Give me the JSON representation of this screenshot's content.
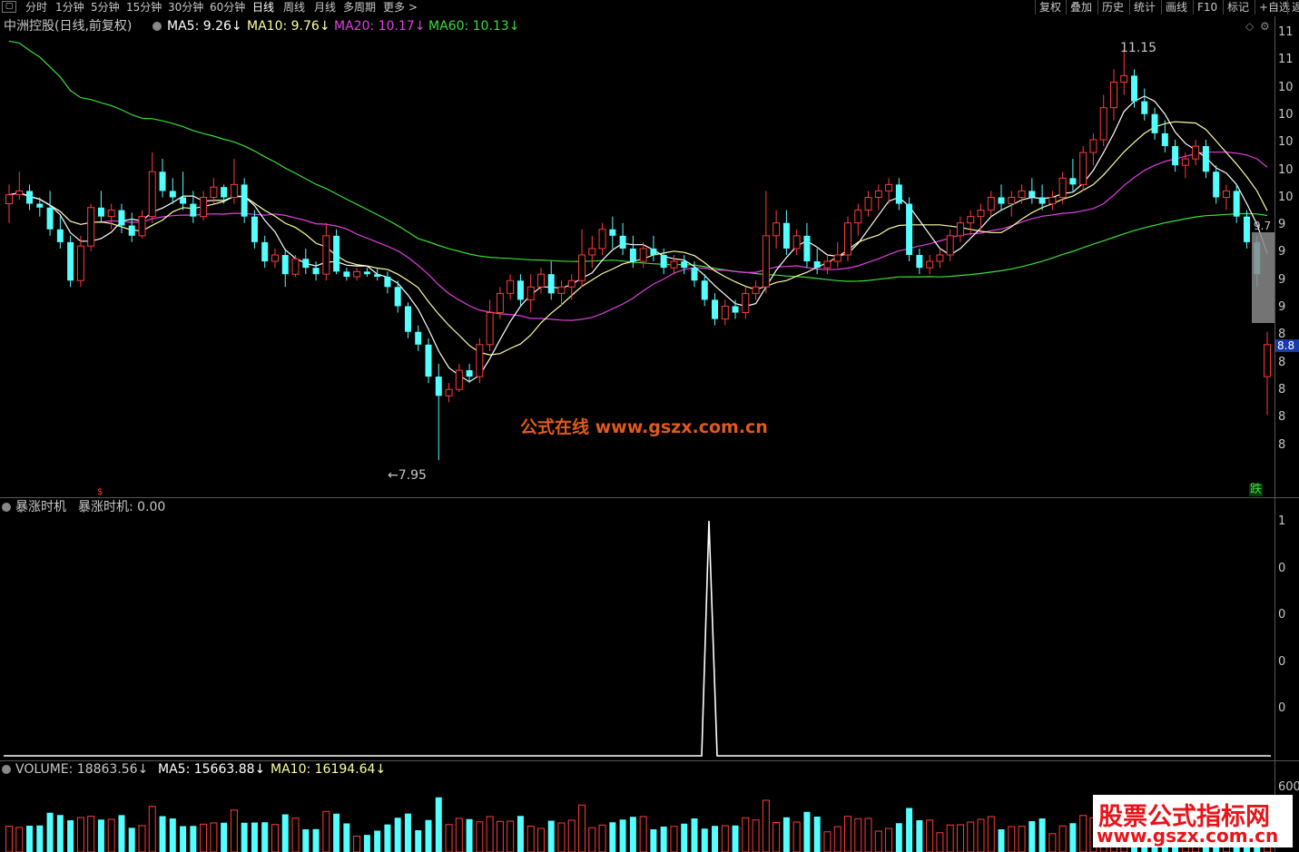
{
  "toolbar": {
    "periods": [
      "分时",
      "1分钟",
      "5分钟",
      "15分钟",
      "30分钟",
      "60分钟",
      "日线",
      "周线",
      "月线",
      "多周期",
      "更多 >"
    ],
    "active_period": "日线",
    "right_buttons": [
      "复权",
      "叠加",
      "历史",
      "统计",
      "画线",
      "F10",
      "标记",
      "+自选",
      "返"
    ]
  },
  "main_panel": {
    "title": "中洲控股(日线,前复权)",
    "ma5": "MA5: 9.26",
    "ma10": "MA10: 9.76",
    "ma20": "MA20: 10.17",
    "ma60": "MA60: 10.13",
    "high_label": "11.15",
    "low_label": "7.95",
    "price_tag": "8.8",
    "price_tag2": "9.7",
    "down_badge": "跌",
    "y_ticks": [
      "11",
      "11",
      "10",
      "10",
      "10",
      "10",
      "10",
      "9",
      "9",
      "9",
      "9",
      "8",
      "8",
      "8",
      "8",
      "8"
    ]
  },
  "indicator_panel": {
    "title": "暴涨时机",
    "value": "暴涨时机: 0.00",
    "y_ticks": [
      "1",
      "0",
      "0",
      "0",
      "0"
    ]
  },
  "volume_panel": {
    "volume": "VOLUME: 18863.56",
    "ma5": "MA5: 15663.88",
    "ma10": "MA10: 16194.64",
    "y_tick": "600"
  },
  "watermarks": {
    "center": "公式在线 www.gszx.com.cn",
    "corner_line1": "股票公式指标网",
    "corner_line2": "www.gszx.com.cn"
  },
  "colors": {
    "up": "#ff3b3b",
    "down": "#54ffff",
    "ma5": "#ffffff",
    "ma10": "#ffff9f",
    "ma20": "#e040e0",
    "ma60": "#3cdc3c",
    "background": "#000000"
  },
  "chart_data": {
    "type": "candlestick",
    "title": "中洲控股(日线,前复权)",
    "price_range": [
      7.8,
      11.3
    ],
    "high": 11.15,
    "low": 7.95,
    "ohlc": [
      [
        9.95,
        10.1,
        9.8,
        10.02
      ],
      [
        10.02,
        10.2,
        9.98,
        10.05
      ],
      [
        10.05,
        10.1,
        9.9,
        9.95
      ],
      [
        9.95,
        10.0,
        9.85,
        9.92
      ],
      [
        9.92,
        10.05,
        9.7,
        9.75
      ],
      [
        9.75,
        9.85,
        9.6,
        9.65
      ],
      [
        9.65,
        9.7,
        9.3,
        9.35
      ],
      [
        9.35,
        9.7,
        9.3,
        9.62
      ],
      [
        9.62,
        9.95,
        9.58,
        9.92
      ],
      [
        9.92,
        10.05,
        9.8,
        9.85
      ],
      [
        9.85,
        9.95,
        9.75,
        9.9
      ],
      [
        9.9,
        9.95,
        9.72,
        9.78
      ],
      [
        9.78,
        9.88,
        9.65,
        9.7
      ],
      [
        9.7,
        9.9,
        9.68,
        9.85
      ],
      [
        9.85,
        10.35,
        9.8,
        10.2
      ],
      [
        10.2,
        10.3,
        10.0,
        10.05
      ],
      [
        10.05,
        10.15,
        9.95,
        10.0
      ],
      [
        10.0,
        10.2,
        9.9,
        9.95
      ],
      [
        9.95,
        10.05,
        9.8,
        9.85
      ],
      [
        9.85,
        10.05,
        9.82,
        10.0
      ],
      [
        10.0,
        10.15,
        9.95,
        10.08
      ],
      [
        10.08,
        10.1,
        9.95,
        10.0
      ],
      [
        10.0,
        10.3,
        9.95,
        10.1
      ],
      [
        10.1,
        10.15,
        9.8,
        9.85
      ],
      [
        9.85,
        9.9,
        9.6,
        9.65
      ],
      [
        9.65,
        9.7,
        9.45,
        9.5
      ],
      [
        9.5,
        9.6,
        9.45,
        9.55
      ],
      [
        9.55,
        9.6,
        9.3,
        9.4
      ],
      [
        9.4,
        9.55,
        9.38,
        9.52
      ],
      [
        9.52,
        9.6,
        9.4,
        9.45
      ],
      [
        9.45,
        9.5,
        9.35,
        9.4
      ],
      [
        9.4,
        9.8,
        9.35,
        9.7
      ],
      [
        9.7,
        9.75,
        9.4,
        9.42
      ],
      [
        9.42,
        9.45,
        9.35,
        9.38
      ],
      [
        9.38,
        9.45,
        9.35,
        9.42
      ],
      [
        9.42,
        9.45,
        9.38,
        9.4
      ],
      [
        9.4,
        9.45,
        9.35,
        9.38
      ],
      [
        9.38,
        9.42,
        9.25,
        9.3
      ],
      [
        9.3,
        9.35,
        9.1,
        9.15
      ],
      [
        9.15,
        9.18,
        8.9,
        8.95
      ],
      [
        8.95,
        9.0,
        8.8,
        8.85
      ],
      [
        8.85,
        8.9,
        8.55,
        8.6
      ],
      [
        8.6,
        8.7,
        7.95,
        8.45
      ],
      [
        8.45,
        8.55,
        8.4,
        8.5
      ],
      [
        8.5,
        8.7,
        8.48,
        8.65
      ],
      [
        8.65,
        8.7,
        8.55,
        8.6
      ],
      [
        8.6,
        8.9,
        8.55,
        8.85
      ],
      [
        8.85,
        9.2,
        8.8,
        9.1
      ],
      [
        9.1,
        9.3,
        9.05,
        9.25
      ],
      [
        9.25,
        9.4,
        9.2,
        9.35
      ],
      [
        9.35,
        9.4,
        9.15,
        9.2
      ],
      [
        9.2,
        9.4,
        9.1,
        9.3
      ],
      [
        9.3,
        9.45,
        9.25,
        9.4
      ],
      [
        9.4,
        9.5,
        9.2,
        9.25
      ],
      [
        9.25,
        9.35,
        9.15,
        9.3
      ],
      [
        9.3,
        9.4,
        9.2,
        9.35
      ],
      [
        9.35,
        9.75,
        9.3,
        9.55
      ],
      [
        9.55,
        9.7,
        9.45,
        9.6
      ],
      [
        9.6,
        9.8,
        9.55,
        9.75
      ],
      [
        9.75,
        9.85,
        9.6,
        9.7
      ],
      [
        9.7,
        9.8,
        9.55,
        9.6
      ],
      [
        9.6,
        9.7,
        9.45,
        9.5
      ],
      [
        9.5,
        9.65,
        9.45,
        9.6
      ],
      [
        9.6,
        9.7,
        9.5,
        9.55
      ],
      [
        9.55,
        9.6,
        9.4,
        9.45
      ],
      [
        9.45,
        9.55,
        9.4,
        9.5
      ],
      [
        9.5,
        9.55,
        9.4,
        9.45
      ],
      [
        9.45,
        9.5,
        9.3,
        9.35
      ],
      [
        9.35,
        9.4,
        9.15,
        9.2
      ],
      [
        9.2,
        9.25,
        9.0,
        9.05
      ],
      [
        9.05,
        9.2,
        9.0,
        9.15
      ],
      [
        9.15,
        9.2,
        9.05,
        9.1
      ],
      [
        9.1,
        9.3,
        9.05,
        9.25
      ],
      [
        9.25,
        9.35,
        9.2,
        9.3
      ],
      [
        9.3,
        10.05,
        9.25,
        9.7
      ],
      [
        9.7,
        9.9,
        9.6,
        9.8
      ],
      [
        9.8,
        9.9,
        9.55,
        9.6
      ],
      [
        9.6,
        9.75,
        9.55,
        9.7
      ],
      [
        9.7,
        9.8,
        9.45,
        9.5
      ],
      [
        9.5,
        9.6,
        9.4,
        9.45
      ],
      [
        9.45,
        9.55,
        9.4,
        9.5
      ],
      [
        9.5,
        9.65,
        9.45,
        9.55
      ],
      [
        9.55,
        9.85,
        9.5,
        9.8
      ],
      [
        9.8,
        9.95,
        9.7,
        9.9
      ],
      [
        9.9,
        10.05,
        9.85,
        10.0
      ],
      [
        10.0,
        10.1,
        9.9,
        10.05
      ],
      [
        10.05,
        10.15,
        9.95,
        10.1
      ],
      [
        10.1,
        10.15,
        9.9,
        9.95
      ],
      [
        9.95,
        10.0,
        9.5,
        9.55
      ],
      [
        9.55,
        9.6,
        9.4,
        9.45
      ],
      [
        9.45,
        9.55,
        9.4,
        9.5
      ],
      [
        9.5,
        9.6,
        9.45,
        9.55
      ],
      [
        9.55,
        9.75,
        9.5,
        9.7
      ],
      [
        9.7,
        9.85,
        9.65,
        9.8
      ],
      [
        9.8,
        9.9,
        9.7,
        9.85
      ],
      [
        9.85,
        9.95,
        9.75,
        9.9
      ],
      [
        9.9,
        10.05,
        9.85,
        10.0
      ],
      [
        10.0,
        10.1,
        9.9,
        9.95
      ],
      [
        9.95,
        10.05,
        9.85,
        10.0
      ],
      [
        10.0,
        10.1,
        9.95,
        10.05
      ],
      [
        10.05,
        10.15,
        9.95,
        10.0
      ],
      [
        10.0,
        10.1,
        9.9,
        9.95
      ],
      [
        9.95,
        10.05,
        9.9,
        10.0
      ],
      [
        10.0,
        10.2,
        9.95,
        10.15
      ],
      [
        10.15,
        10.3,
        10.05,
        10.1
      ],
      [
        10.1,
        10.4,
        10.05,
        10.35
      ],
      [
        10.35,
        10.5,
        10.25,
        10.45
      ],
      [
        10.45,
        10.8,
        10.4,
        10.7
      ],
      [
        10.7,
        11.0,
        10.6,
        10.9
      ],
      [
        10.9,
        11.15,
        10.8,
        10.95
      ],
      [
        10.95,
        11.0,
        10.7,
        10.75
      ],
      [
        10.75,
        10.85,
        10.6,
        10.65
      ],
      [
        10.65,
        10.7,
        10.45,
        10.5
      ],
      [
        10.5,
        10.6,
        10.35,
        10.4
      ],
      [
        10.4,
        10.45,
        10.2,
        10.25
      ],
      [
        10.25,
        10.35,
        10.15,
        10.3
      ],
      [
        10.3,
        10.45,
        10.25,
        10.4
      ],
      [
        10.4,
        10.45,
        10.15,
        10.2
      ],
      [
        10.2,
        10.25,
        9.95,
        10.0
      ],
      [
        10.0,
        10.1,
        9.9,
        10.05
      ],
      [
        10.05,
        10.1,
        9.8,
        9.85
      ],
      [
        9.85,
        9.9,
        9.6,
        9.65
      ],
      [
        9.65,
        9.7,
        9.3,
        9.4
      ],
      [
        8.6,
        8.95,
        8.3,
        8.85
      ]
    ]
  }
}
